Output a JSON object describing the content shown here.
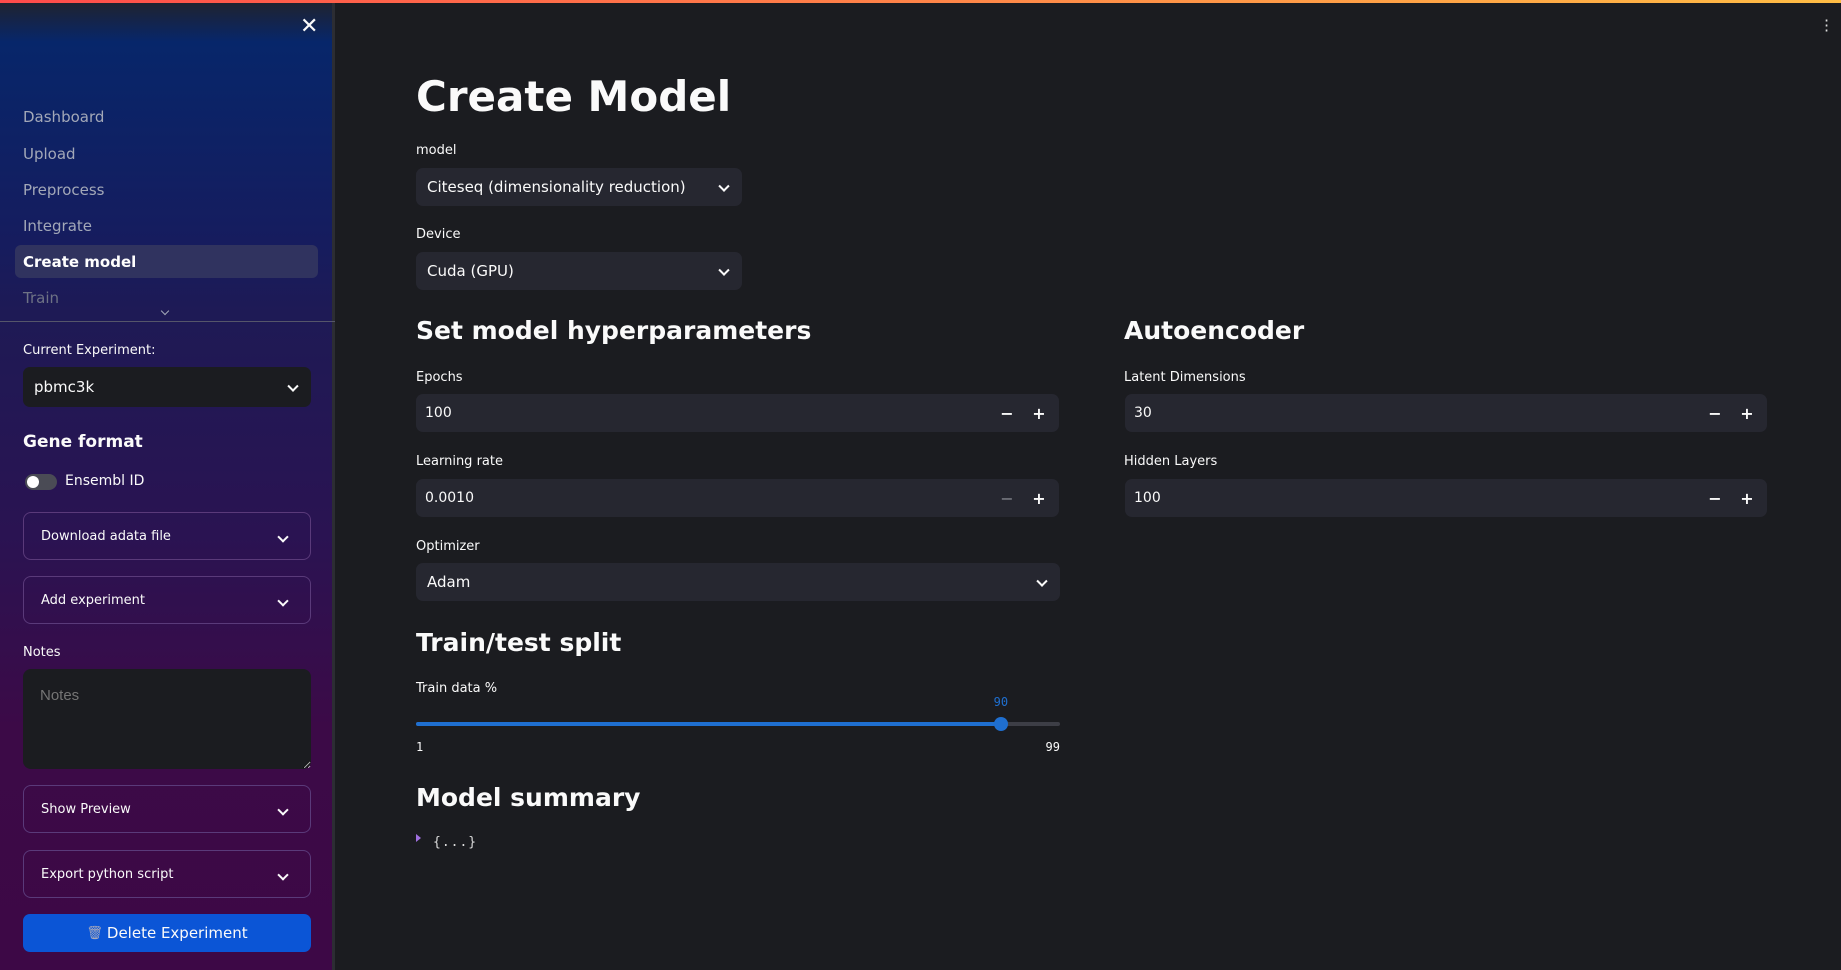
{
  "sidebar": {
    "nav": [
      "Dashboard",
      "Upload",
      "Preprocess",
      "Integrate",
      "Create model",
      "Train"
    ],
    "active_index": 4,
    "current_experiment_label": "Current Experiment:",
    "current_experiment_value": "pbmc3k",
    "gene_format_heading": "Gene format",
    "ensembl_toggle_label": "Ensembl ID",
    "ensembl_toggle_on": false,
    "download_label": "Download adata file",
    "add_experiment_label": "Add experiment",
    "notes_label": "Notes",
    "notes_placeholder": "Notes",
    "show_preview_label": "Show Preview",
    "export_label": "Export python script",
    "delete_label": "Delete Experiment",
    "delete_icon": "🗑"
  },
  "main": {
    "title": "Create Model",
    "model_label": "model",
    "model_value": "Citeseq (dimensionality reduction)",
    "device_label": "Device",
    "device_value": "Cuda (GPU)",
    "hyper_heading": "Set model hyperparameters",
    "epochs_label": "Epochs",
    "epochs_value": "100",
    "lr_label": "Learning rate",
    "lr_value": "0.0010",
    "optimizer_label": "Optimizer",
    "optimizer_value": "Adam",
    "ae_heading": "Autoencoder",
    "latent_label": "Latent Dimensions",
    "latent_value": "30",
    "hidden_label": "Hidden Layers",
    "hidden_value": "100",
    "split_heading": "Train/test split",
    "train_label": "Train data %",
    "train_value": 90,
    "train_min": 1,
    "train_max": 99,
    "summary_heading": "Model summary",
    "summary_json": "{...}"
  },
  "colors": {
    "accent": "#1f6fd0",
    "delete_button": "#0b55d6"
  }
}
